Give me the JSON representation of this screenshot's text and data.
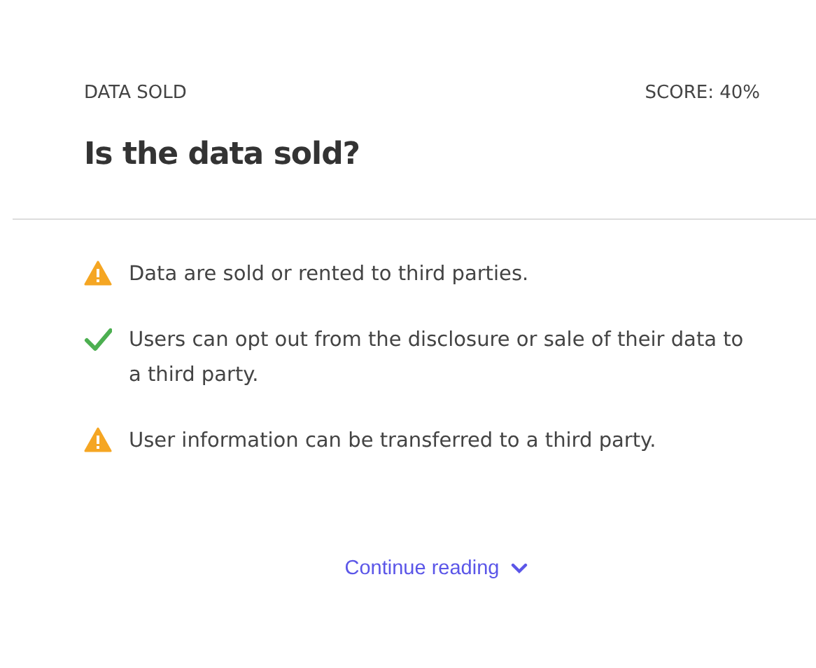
{
  "category": "DATA SOLD",
  "score": "SCORE: 40%",
  "title": "Is the data sold?",
  "items": [
    {
      "kind": "warning",
      "text": "Data are sold or rented to third parties."
    },
    {
      "kind": "good",
      "text": "Users can opt out from the disclosure or sale of their data to a third party."
    },
    {
      "kind": "warning",
      "text": "User information can be transferred to a third party."
    }
  ],
  "link": "Continue reading"
}
